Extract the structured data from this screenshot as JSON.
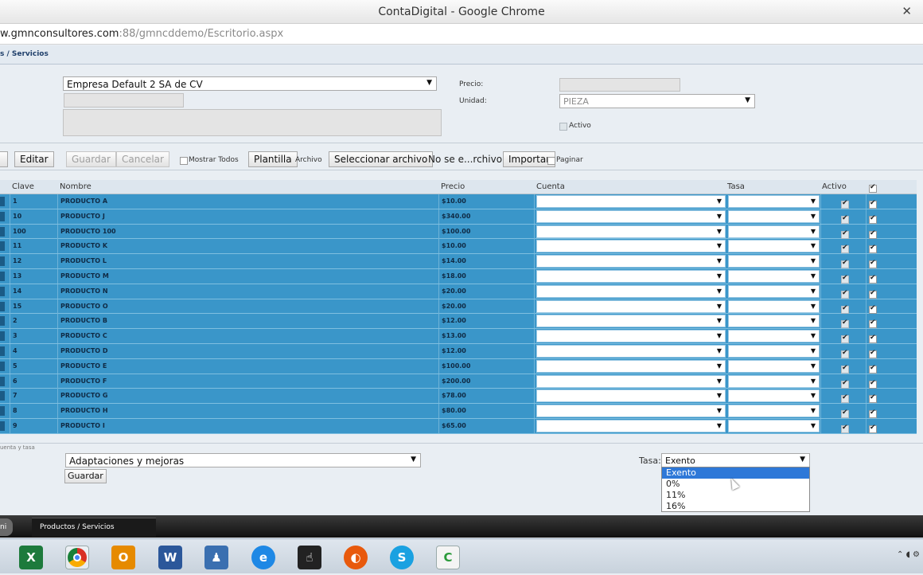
{
  "browser": {
    "window_title": "ContaDigital - Google Chrome",
    "url_host": "w.gmnconsultores.com",
    "url_path": ":88/gmncddemo/Escritorio.aspx"
  },
  "breadcrumb": "s / Servicios",
  "form": {
    "empresa_value": "Empresa Default 2 SA de CV",
    "precio_label": "Precio:",
    "unidad_label": "Unidad:",
    "unidad_value": "PIEZA",
    "activo_label": "Activo"
  },
  "toolbar": {
    "editar": "Editar",
    "guardar": "Guardar",
    "cancelar": "Cancelar",
    "mostrar_todos": "Mostrar Todos",
    "plantilla": "Plantilla",
    "archivo_label": "Archivo",
    "seleccionar_archivo": "Seleccionar archivo",
    "archivo_status": "No se e...rchivo",
    "importar": "Importar",
    "paginar": "Paginar"
  },
  "grid": {
    "headers": {
      "clave": "Clave",
      "nombre": "Nombre",
      "precio": "Precio",
      "cuenta": "Cuenta",
      "tasa": "Tasa",
      "activo": "Activo"
    },
    "rows": [
      {
        "clave": "1",
        "nombre": "PRODUCTO A",
        "precio": "$10.00"
      },
      {
        "clave": "10",
        "nombre": "PRODUCTO J",
        "precio": "$340.00"
      },
      {
        "clave": "100",
        "nombre": "PRODUCTO 100",
        "precio": "$100.00"
      },
      {
        "clave": "11",
        "nombre": "PRODUCTO K",
        "precio": "$10.00"
      },
      {
        "clave": "12",
        "nombre": "PRODUCTO L",
        "precio": "$14.00"
      },
      {
        "clave": "13",
        "nombre": "PRODUCTO M",
        "precio": "$18.00"
      },
      {
        "clave": "14",
        "nombre": "PRODUCTO N",
        "precio": "$20.00"
      },
      {
        "clave": "15",
        "nombre": "PRODUCTO O",
        "precio": "$20.00"
      },
      {
        "clave": "2",
        "nombre": "PRODUCTO B",
        "precio": "$12.00"
      },
      {
        "clave": "3",
        "nombre": "PRODUCTO C",
        "precio": "$13.00"
      },
      {
        "clave": "4",
        "nombre": "PRODUCTO D",
        "precio": "$12.00"
      },
      {
        "clave": "5",
        "nombre": "PRODUCTO E",
        "precio": "$100.00"
      },
      {
        "clave": "6",
        "nombre": "PRODUCTO F",
        "precio": "$200.00"
      },
      {
        "clave": "7",
        "nombre": "PRODUCTO G",
        "precio": "$78.00"
      },
      {
        "clave": "8",
        "nombre": "PRODUCTO H",
        "precio": "$80.00"
      },
      {
        "clave": "9",
        "nombre": "PRODUCTO I",
        "precio": "$65.00"
      }
    ]
  },
  "bulk": {
    "section_label": "uenta y tasa",
    "cuenta_value": "Adaptaciones y mejoras",
    "guardar": "Guardar",
    "tasa_label": "Tasa:",
    "tasa_value": "Exento",
    "tasa_options": [
      "Exento",
      "0%",
      "11%",
      "16%"
    ]
  },
  "tabs": {
    "active_tab": "ni",
    "tab": "Productos / Servicios"
  },
  "colors": {
    "row_selected": "#3a96c9",
    "dropdown_highlight": "#2e78d8"
  }
}
